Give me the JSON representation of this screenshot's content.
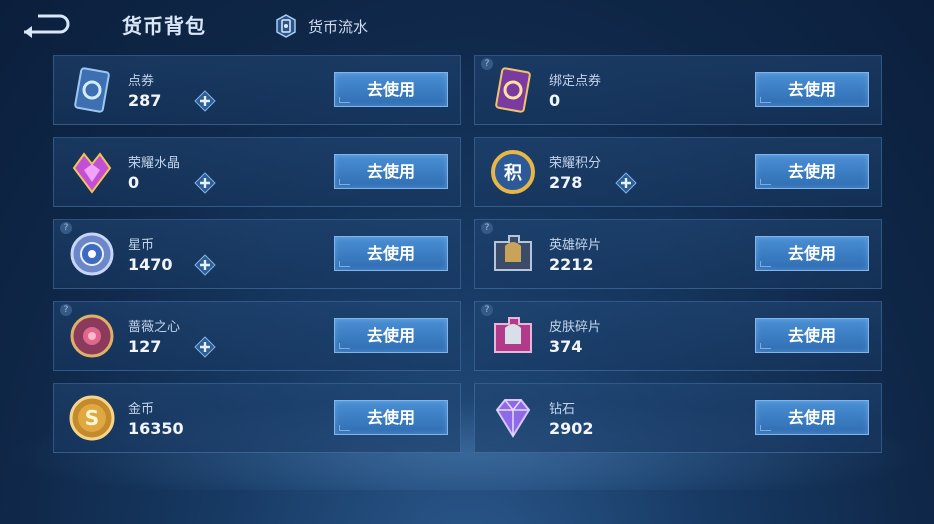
{
  "header": {
    "title": "货币背包",
    "flow_label": "货币流水"
  },
  "cards": [
    {
      "id": "dianquan",
      "name": "点券",
      "amount": "287",
      "plus": true,
      "button": "去使用",
      "icon": "ticket-card-icon"
    },
    {
      "id": "bangding",
      "name": "绑定点券",
      "amount": "0",
      "plus": false,
      "help": true,
      "button": "去使用",
      "icon": "bound-ticket-card-icon"
    },
    {
      "id": "shuijing",
      "name": "荣耀水晶",
      "amount": "0",
      "plus": true,
      "button": "去使用",
      "icon": "glory-crystal-icon"
    },
    {
      "id": "jifen",
      "name": "荣耀积分",
      "amount": "278",
      "plus": true,
      "button": "去使用",
      "icon": "glory-points-icon"
    },
    {
      "id": "xingbi",
      "name": "星币",
      "amount": "1470",
      "plus": true,
      "help": true,
      "button": "去使用",
      "icon": "star-coin-icon"
    },
    {
      "id": "yingxiong",
      "name": "英雄碎片",
      "amount": "2212",
      "plus": false,
      "help": true,
      "button": "去使用",
      "icon": "hero-fragment-icon"
    },
    {
      "id": "qiangwei",
      "name": "蔷薇之心",
      "amount": "127",
      "plus": true,
      "help": true,
      "button": "去使用",
      "icon": "rose-heart-icon"
    },
    {
      "id": "pifu",
      "name": "皮肤碎片",
      "amount": "374",
      "plus": false,
      "help": true,
      "button": "去使用",
      "icon": "skin-fragment-icon"
    },
    {
      "id": "jinbi",
      "name": "金币",
      "amount": "16350",
      "plus": false,
      "button": "去使用",
      "icon": "gold-coin-icon"
    },
    {
      "id": "zuanshi",
      "name": "钻石",
      "amount": "2902",
      "plus": false,
      "button": "去使用",
      "icon": "diamond-icon"
    }
  ],
  "help_glyph": "?",
  "colors": {
    "button": "#3a7cc4",
    "card_border": "#6096d2",
    "background": "#173a64"
  }
}
